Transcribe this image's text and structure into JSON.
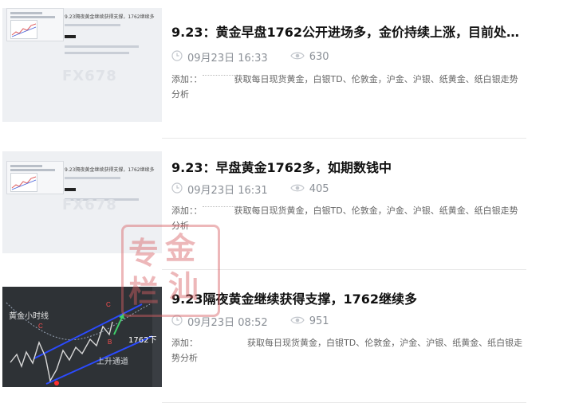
{
  "articles": [
    {
      "title": "9.23：黄金早盘1762公开进场多，金价持续上涨，目前处于...",
      "date": "09月23日 16:33",
      "views": "630",
      "desc_prefix": "添加：：",
      "desc_rest": "获取每日现货黄金，白银TD、伦敦金，沪金、沪银、纸黄金、纸白银走势分析",
      "thumb_title": "9.23隔夜黄金继续获得支撑，1762继续多",
      "thumb_watermark": "FX678"
    },
    {
      "title": "9.23：早盘黄金1762多，如期数钱中",
      "date": "09月23日 16:31",
      "views": "405",
      "desc_prefix": "添加：：",
      "desc_rest": "获取每日现货黄金，白银TD、伦敦金，沪金、沪银、纸黄金、纸白银走势分析",
      "thumb_title": "9.23隔夜黄金继续获得支撑，1762继续多",
      "thumb_watermark": "FX678"
    },
    {
      "title": "9.23隔夜黄金继续获得支撑，1762继续多",
      "date": "09月23日 08:52",
      "views": "951",
      "desc_prefix": "添加：",
      "desc_rest": "获取每日现货黄金，白银TD、伦敦金，沪金、沪银、纸黄金、纸白银走势分析",
      "thumb_caption": "黄金小时线",
      "thumb_price": "1762下",
      "thumb_channel": "上升通道"
    }
  ],
  "stamp": {
    "chars": [
      "专",
      "金",
      "栏",
      "汕"
    ]
  },
  "icons": {
    "clock": "clock-icon",
    "views": "eye-icon"
  },
  "colors": {
    "title": "#111111",
    "meta": "#8a8f96",
    "stamp": "#d75f64",
    "chart_bg": "#2e3236",
    "channel": "#2b4bff"
  }
}
